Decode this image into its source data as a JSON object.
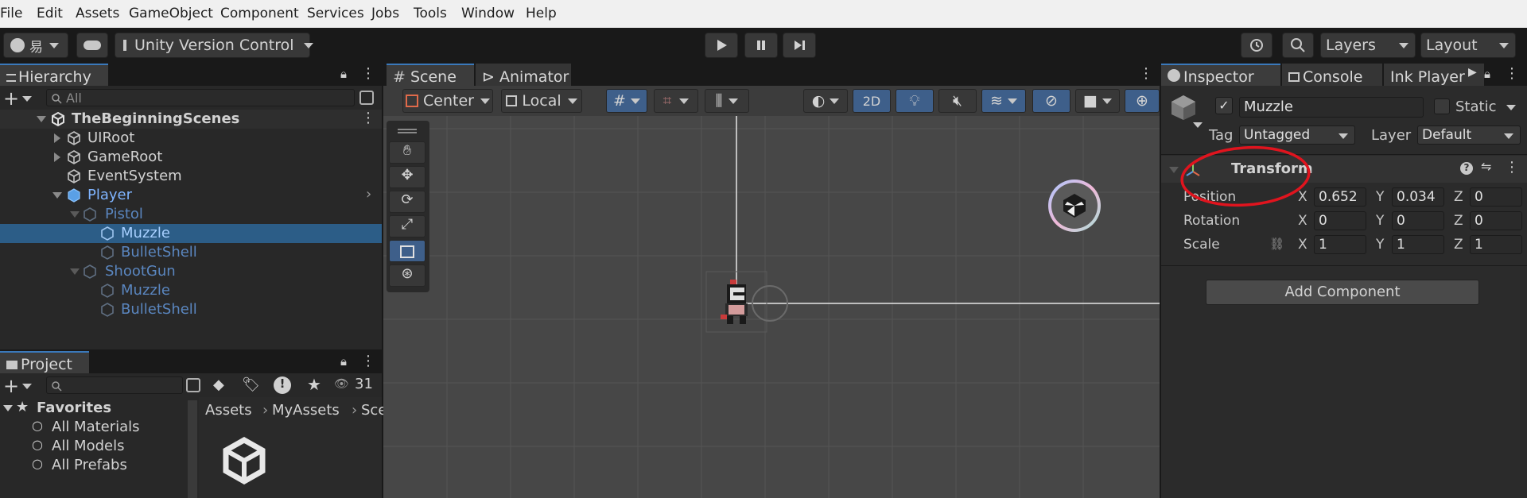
{
  "menu": [
    "File",
    "Edit",
    "Assets",
    "GameObject",
    "Component",
    "Services",
    "Jobs",
    "Tools",
    "Window",
    "Help"
  ],
  "toolbar": {
    "account_label": "易",
    "version_control": "Unity Version Control",
    "layers": "Layers",
    "layout": "Layout"
  },
  "hierarchy": {
    "tab": "Hierarchy",
    "search_placeholder": "All",
    "scene": "TheBeginningScenes",
    "items": [
      "UIRoot",
      "GameRoot",
      "EventSystem",
      "Player",
      "Pistol",
      "Muzzle",
      "BulletShell",
      "ShootGun",
      "Muzzle",
      "BulletShell"
    ]
  },
  "project": {
    "tab": "Project",
    "count": "31",
    "favorites": "Favorites",
    "fav_items": [
      "All Materials",
      "All Models",
      "All Prefabs"
    ],
    "breadcrumb": [
      "Assets",
      "MyAssets",
      "Sce"
    ]
  },
  "scene": {
    "tabs": [
      "Scene",
      "Animator"
    ],
    "pivot": "Center",
    "space": "Local",
    "mode_2d": "2D"
  },
  "inspector": {
    "tabs": [
      "Inspector",
      "Console",
      "Ink Player"
    ],
    "object_name": "Muzzle",
    "static_label": "Static",
    "tag_label": "Tag",
    "tag_value": "Untagged",
    "layer_label": "Layer",
    "layer_value": "Default",
    "component": "Transform",
    "position_label": "Position",
    "rotation_label": "Rotation",
    "scale_label": "Scale",
    "axis": [
      "X",
      "Y",
      "Z"
    ],
    "position": [
      "0.652",
      "0.034",
      "0"
    ],
    "rotation": [
      "0",
      "0",
      "0"
    ],
    "scale": [
      "1",
      "1",
      "1"
    ],
    "add_component": "Add Component"
  },
  "colors": {
    "accent": "#3a79bb",
    "selection": "#2c5d87",
    "annotation": "#e0141e"
  }
}
